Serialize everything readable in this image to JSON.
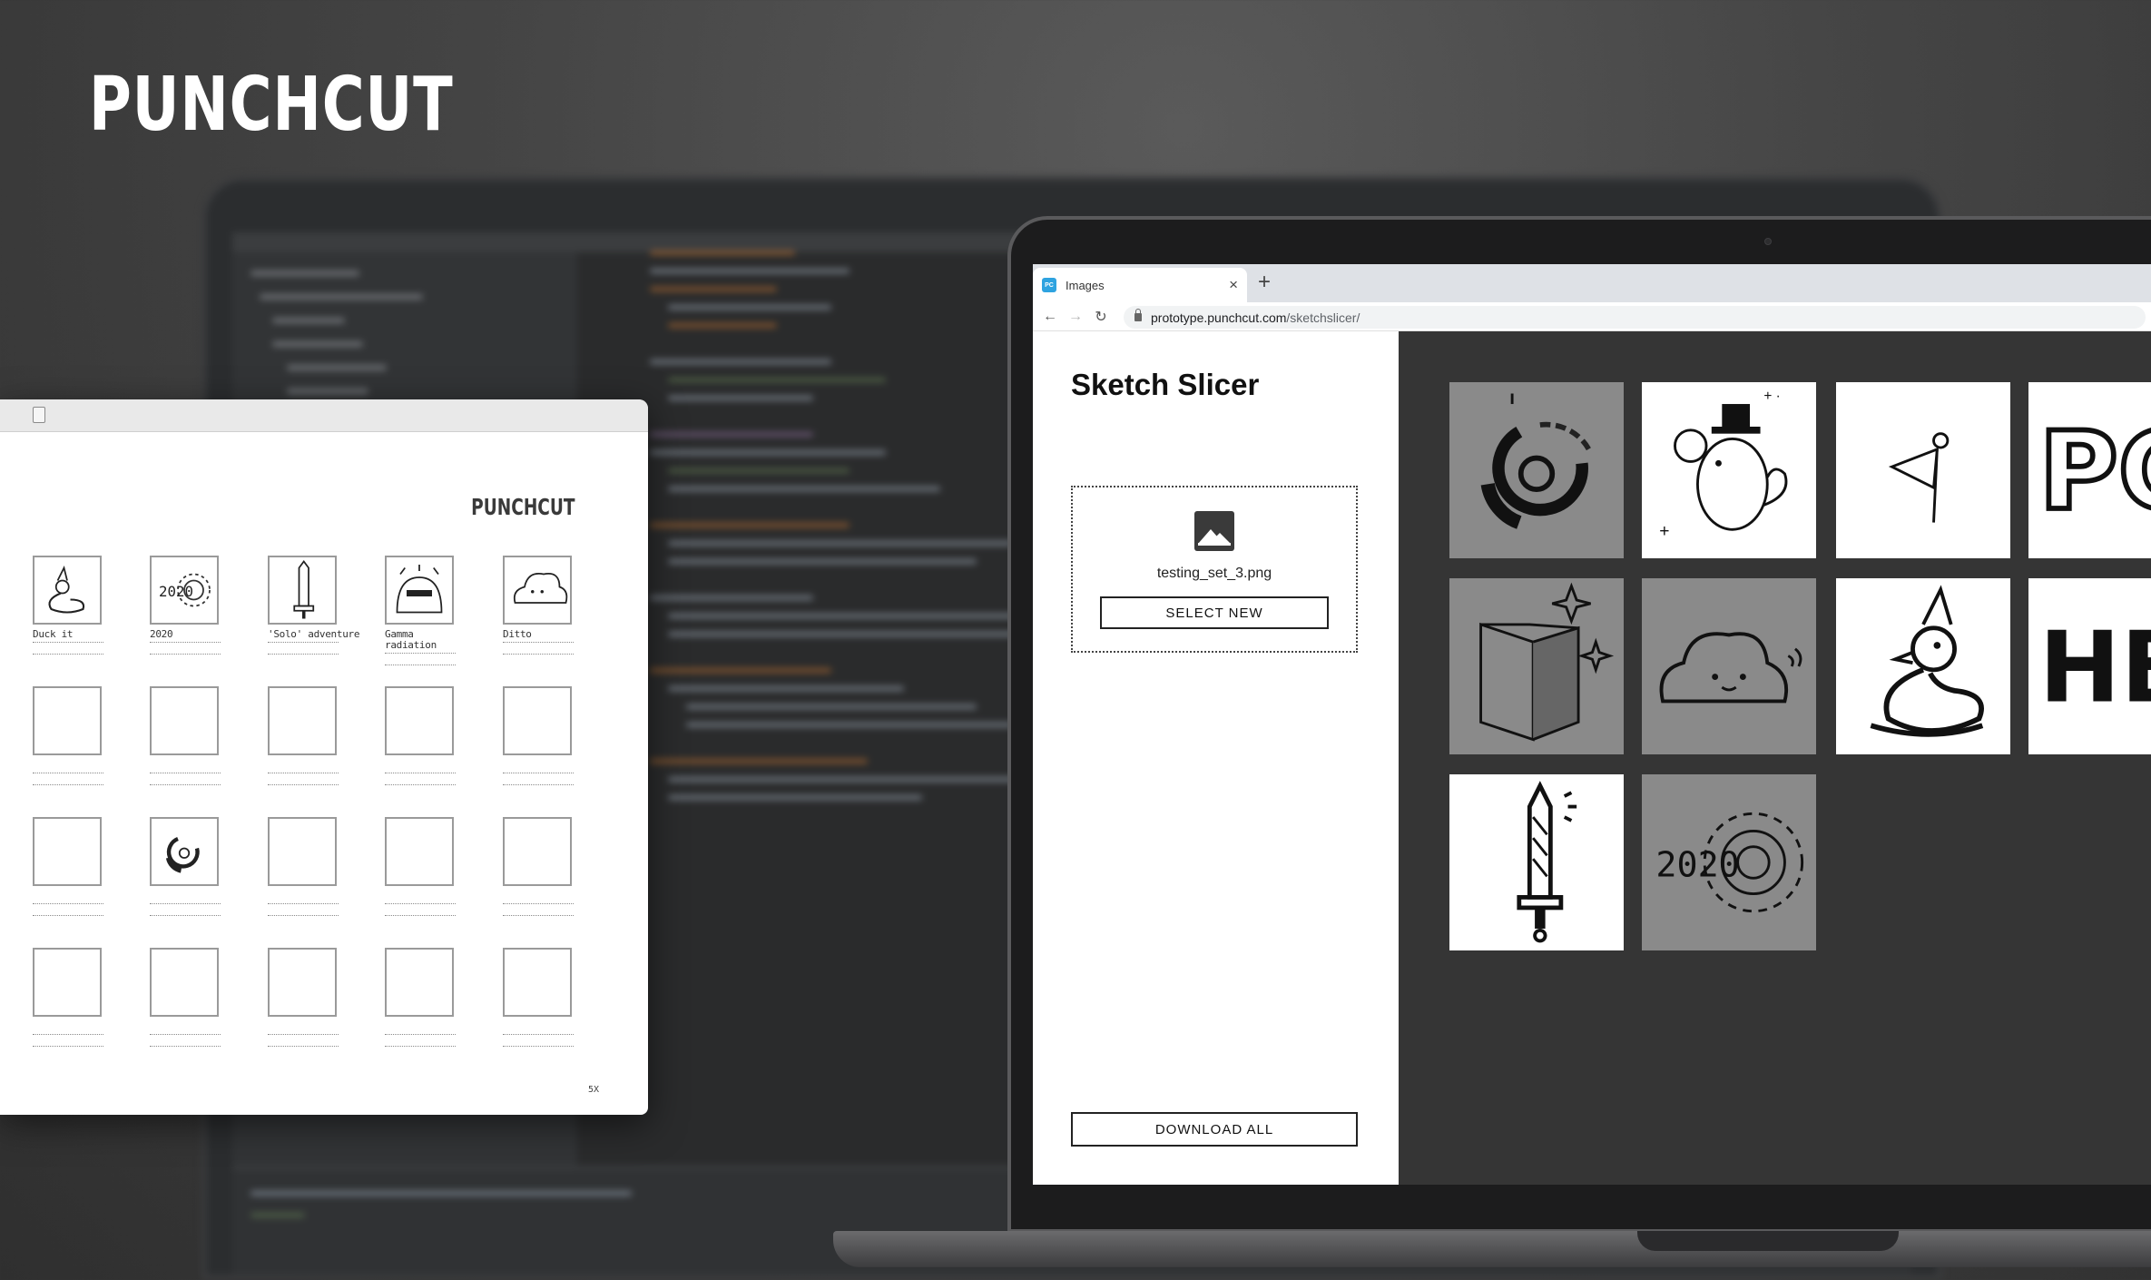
{
  "brand": "PUNCHCUT",
  "sheet": {
    "brand": "PUNCHCUT",
    "page_number": "5X",
    "row1_labels": [
      "Duck it",
      "2020",
      "'Solo' adventure",
      "Gamma",
      "Ditto"
    ],
    "row1_label2": "radiation"
  },
  "browser": {
    "tab_title": "Images",
    "favicon_text": "PC",
    "url_domain": "prototype.punchcut.com",
    "url_path": "/sketchslicer/",
    "back_icon": "arrow-left-icon",
    "forward_icon": "arrow-right-icon",
    "reload_icon": "reload-icon"
  },
  "app": {
    "title": "Sketch Slicer",
    "file_name": "testing_set_3.png",
    "select_label": "SELECT NEW",
    "download_label": "DOWNLOAD ALL"
  },
  "gallery": {
    "thumbs": [
      {
        "icon": "ring-sketch-icon",
        "bg": "grey"
      },
      {
        "icon": "mouse-top-hat-sketch-icon",
        "bg": "white"
      },
      {
        "icon": "flag-sketch-icon",
        "bg": "white"
      },
      {
        "icon": "pc-letters-sketch-icon",
        "bg": "white",
        "text": "PC"
      },
      {
        "icon": "book-sketch-icon",
        "bg": "grey"
      },
      {
        "icon": "blob-sketch-icon",
        "bg": "grey"
      },
      {
        "icon": "duck-party-hat-sketch-icon",
        "bg": "white"
      },
      {
        "icon": "hb-letters-sketch-icon",
        "bg": "white",
        "text": "HB"
      },
      {
        "icon": "sword-sketch-icon",
        "bg": "white"
      },
      {
        "icon": "2020-spiral-sketch-icon",
        "bg": "grey",
        "text": "2020"
      }
    ]
  }
}
